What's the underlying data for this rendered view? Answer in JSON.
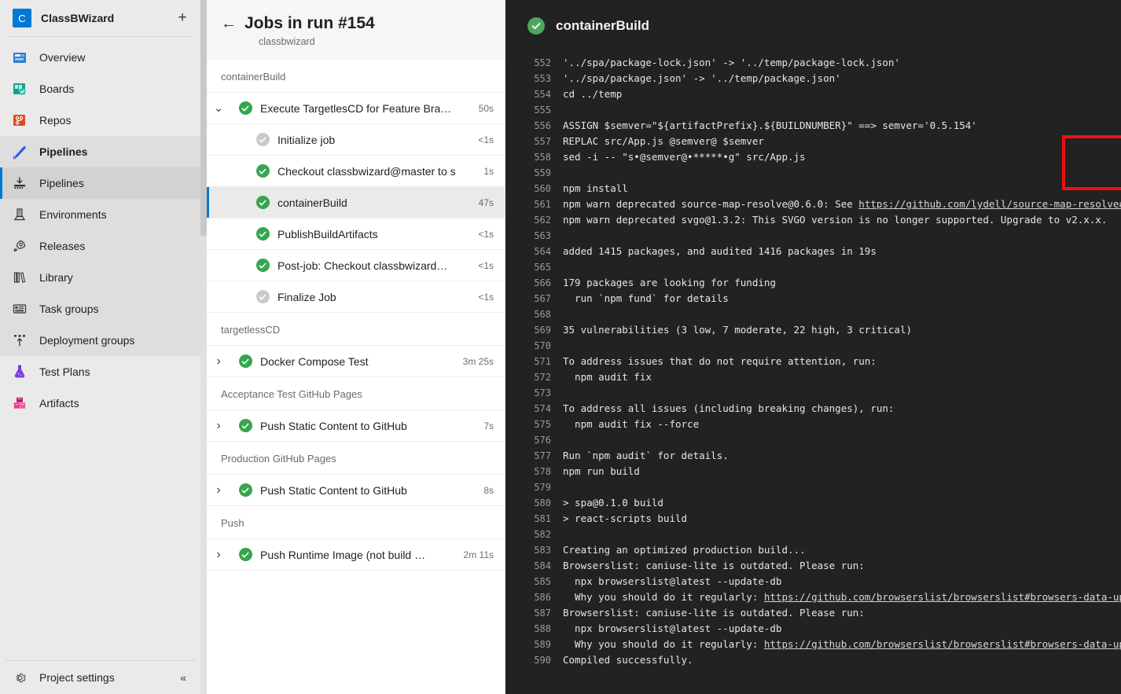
{
  "sidebar": {
    "project": {
      "initial": "C",
      "name": "ClassBWizard",
      "add_label": "+"
    },
    "items": [
      {
        "label": "Overview",
        "icon": "overview-icon"
      },
      {
        "label": "Boards",
        "icon": "boards-icon"
      },
      {
        "label": "Repos",
        "icon": "repos-icon"
      },
      {
        "label": "Pipelines",
        "icon": "pipelines-icon"
      },
      {
        "label": "Pipelines",
        "icon": "pipelines-sub-icon"
      },
      {
        "label": "Environments",
        "icon": "environments-icon"
      },
      {
        "label": "Releases",
        "icon": "releases-icon"
      },
      {
        "label": "Library",
        "icon": "library-icon"
      },
      {
        "label": "Task groups",
        "icon": "task-groups-icon"
      },
      {
        "label": "Deployment groups",
        "icon": "deployment-groups-icon"
      },
      {
        "label": "Test Plans",
        "icon": "test-plans-icon"
      },
      {
        "label": "Artifacts",
        "icon": "artifacts-icon"
      }
    ],
    "footer": {
      "label": "Project settings",
      "collapse": "«"
    }
  },
  "jobs_panel": {
    "back": "←",
    "title": "Jobs in run #154",
    "subtitle": "classbwizard",
    "groups": [
      {
        "stage": "containerBuild",
        "rows": [
          {
            "chevron": "⌄",
            "status": "success",
            "name": "Execute TargetlesCD for Feature Bra…",
            "time": "50s",
            "indent": false,
            "selected": false
          },
          {
            "chevron": "",
            "status": "skipped",
            "name": "Initialize job",
            "time": "<1s",
            "indent": true,
            "selected": false
          },
          {
            "chevron": "",
            "status": "success",
            "name": "Checkout classbwizard@master to s",
            "time": "1s",
            "indent": true,
            "selected": false
          },
          {
            "chevron": "",
            "status": "success",
            "name": "containerBuild",
            "time": "47s",
            "indent": true,
            "selected": true
          },
          {
            "chevron": "",
            "status": "success",
            "name": "PublishBuildArtifacts",
            "time": "<1s",
            "indent": true,
            "selected": false
          },
          {
            "chevron": "",
            "status": "success",
            "name": "Post-job: Checkout classbwizard…",
            "time": "<1s",
            "indent": true,
            "selected": false
          },
          {
            "chevron": "",
            "status": "skipped",
            "name": "Finalize Job",
            "time": "<1s",
            "indent": true,
            "selected": false
          }
        ]
      },
      {
        "stage": "targetlessCD",
        "rows": [
          {
            "chevron": "›",
            "status": "success",
            "name": "Docker Compose Test",
            "time": "3m 25s",
            "indent": false,
            "selected": false
          }
        ]
      },
      {
        "stage": "Acceptance Test GitHub Pages",
        "rows": [
          {
            "chevron": "›",
            "status": "success",
            "name": "Push Static Content to GitHub",
            "time": "7s",
            "indent": false,
            "selected": false
          }
        ]
      },
      {
        "stage": "Production GitHub Pages",
        "rows": [
          {
            "chevron": "›",
            "status": "success",
            "name": "Push Static Content to GitHub",
            "time": "8s",
            "indent": false,
            "selected": false
          }
        ]
      },
      {
        "stage": "Push",
        "rows": [
          {
            "chevron": "›",
            "status": "success",
            "name": "Push Runtime Image (not build …",
            "time": "2m 11s",
            "indent": false,
            "selected": false
          }
        ]
      }
    ]
  },
  "log_panel": {
    "status": "success",
    "title": "containerBuild",
    "highlight_color": "#ee1111",
    "lines": [
      {
        "n": "552",
        "text": "'../spa/package-lock.json' -> '../temp/package-lock.json'"
      },
      {
        "n": "553",
        "text": "'../spa/package.json' -> '../temp/package.json'"
      },
      {
        "n": "554",
        "text": "cd ../temp"
      },
      {
        "n": "555",
        "text": ""
      },
      {
        "n": "556",
        "text": "ASSIGN $semver=\"${artifactPrefix}.${BUILDNUMBER}\" ==> semver='0.5.154'"
      },
      {
        "n": "557",
        "text": "REPLAC src/App.js @semver@ $semver"
      },
      {
        "n": "558",
        "text": "sed -i -- \"s•@semver@•*****•g\" src/App.js"
      },
      {
        "n": "559",
        "text": ""
      },
      {
        "n": "560",
        "text": "npm install"
      },
      {
        "n": "561",
        "text": "npm warn deprecated source-map-resolve@0.6.0: See ",
        "link": "https://github.com/lydell/source-map-resolve#deprecated"
      },
      {
        "n": "562",
        "text": "npm warn deprecated svgo@1.3.2: This SVGO version is no longer supported. Upgrade to v2.x.x."
      },
      {
        "n": "563",
        "text": ""
      },
      {
        "n": "564",
        "text": "added 1415 packages, and audited 1416 packages in 19s"
      },
      {
        "n": "565",
        "text": ""
      },
      {
        "n": "566",
        "text": "179 packages are looking for funding"
      },
      {
        "n": "567",
        "text": "  run `npm fund` for details"
      },
      {
        "n": "568",
        "text": ""
      },
      {
        "n": "569",
        "text": "35 vulnerabilities (3 low, 7 moderate, 22 high, 3 critical)"
      },
      {
        "n": "570",
        "text": ""
      },
      {
        "n": "571",
        "text": "To address issues that do not require attention, run:"
      },
      {
        "n": "572",
        "text": "  npm audit fix"
      },
      {
        "n": "573",
        "text": ""
      },
      {
        "n": "574",
        "text": "To address all issues (including breaking changes), run:"
      },
      {
        "n": "575",
        "text": "  npm audit fix --force"
      },
      {
        "n": "576",
        "text": ""
      },
      {
        "n": "577",
        "text": "Run `npm audit` for details."
      },
      {
        "n": "578",
        "text": "npm run build"
      },
      {
        "n": "579",
        "text": ""
      },
      {
        "n": "580",
        "text": "> spa@0.1.0 build"
      },
      {
        "n": "581",
        "text": "> react-scripts build"
      },
      {
        "n": "582",
        "text": ""
      },
      {
        "n": "583",
        "text": "Creating an optimized production build..."
      },
      {
        "n": "584",
        "text": "Browserslist: caniuse-lite is outdated. Please run:"
      },
      {
        "n": "585",
        "text": "  npx browserslist@latest --update-db"
      },
      {
        "n": "586",
        "text": "  Why you should do it regularly: ",
        "link": "https://github.com/browserslist/browserslist#browsers-data-updating"
      },
      {
        "n": "587",
        "text": "Browserslist: caniuse-lite is outdated. Please run:"
      },
      {
        "n": "588",
        "text": "  npx browserslist@latest --update-db"
      },
      {
        "n": "589",
        "text": "  Why you should do it regularly: ",
        "link": "https://github.com/browserslist/browserslist#browsers-data-updating"
      },
      {
        "n": "590",
        "text": "Compiled successfully."
      }
    ]
  }
}
